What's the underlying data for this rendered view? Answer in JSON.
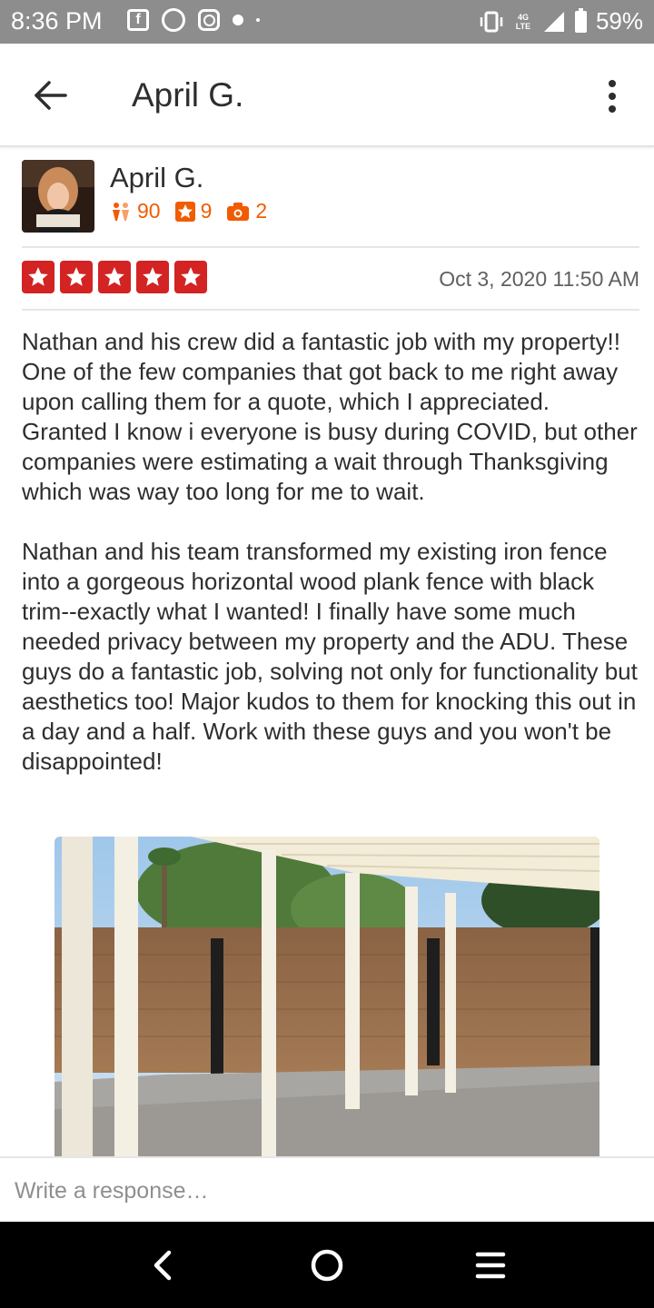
{
  "status_bar": {
    "time": "8:36 PM",
    "battery": "59%",
    "network": "4G LTE",
    "icons": [
      "facebook-icon",
      "whatsapp-icon",
      "instagram-icon",
      "notification-dot-icon",
      "vibrate-icon",
      "signal-icon",
      "battery-icon"
    ]
  },
  "app_bar": {
    "title": "April G."
  },
  "review": {
    "user": {
      "name": "April G.",
      "friends": "90",
      "reviews": "9",
      "photos": "2"
    },
    "rating": 5,
    "date": "Oct 3, 2020 11:50 AM",
    "paragraphs": [
      "Nathan and his crew did a fantastic job with my property!! One of the few companies that got back to me right away upon calling them for a quote, which I appreciated. Granted I know i everyone is busy during COVID, but other companies were estimating a wait through Thanksgiving which was way too long for me to wait.",
      "Nathan and his team transformed my existing iron fence into a gorgeous horizontal wood plank fence with black trim--exactly what I wanted! I finally have some much needed privacy between my property and the ADU. These guys do a fantastic job, solving not only for functionality but aesthetics too! Major kudos to them for knocking this out in a day and a half. Work with these guys and you won't be disappointed!"
    ]
  },
  "response": {
    "placeholder": "Write a response…",
    "value": ""
  },
  "colors": {
    "star_red": "#d32323",
    "stat_orange": "#f15c00",
    "status_gray": "#8d8d8d"
  }
}
